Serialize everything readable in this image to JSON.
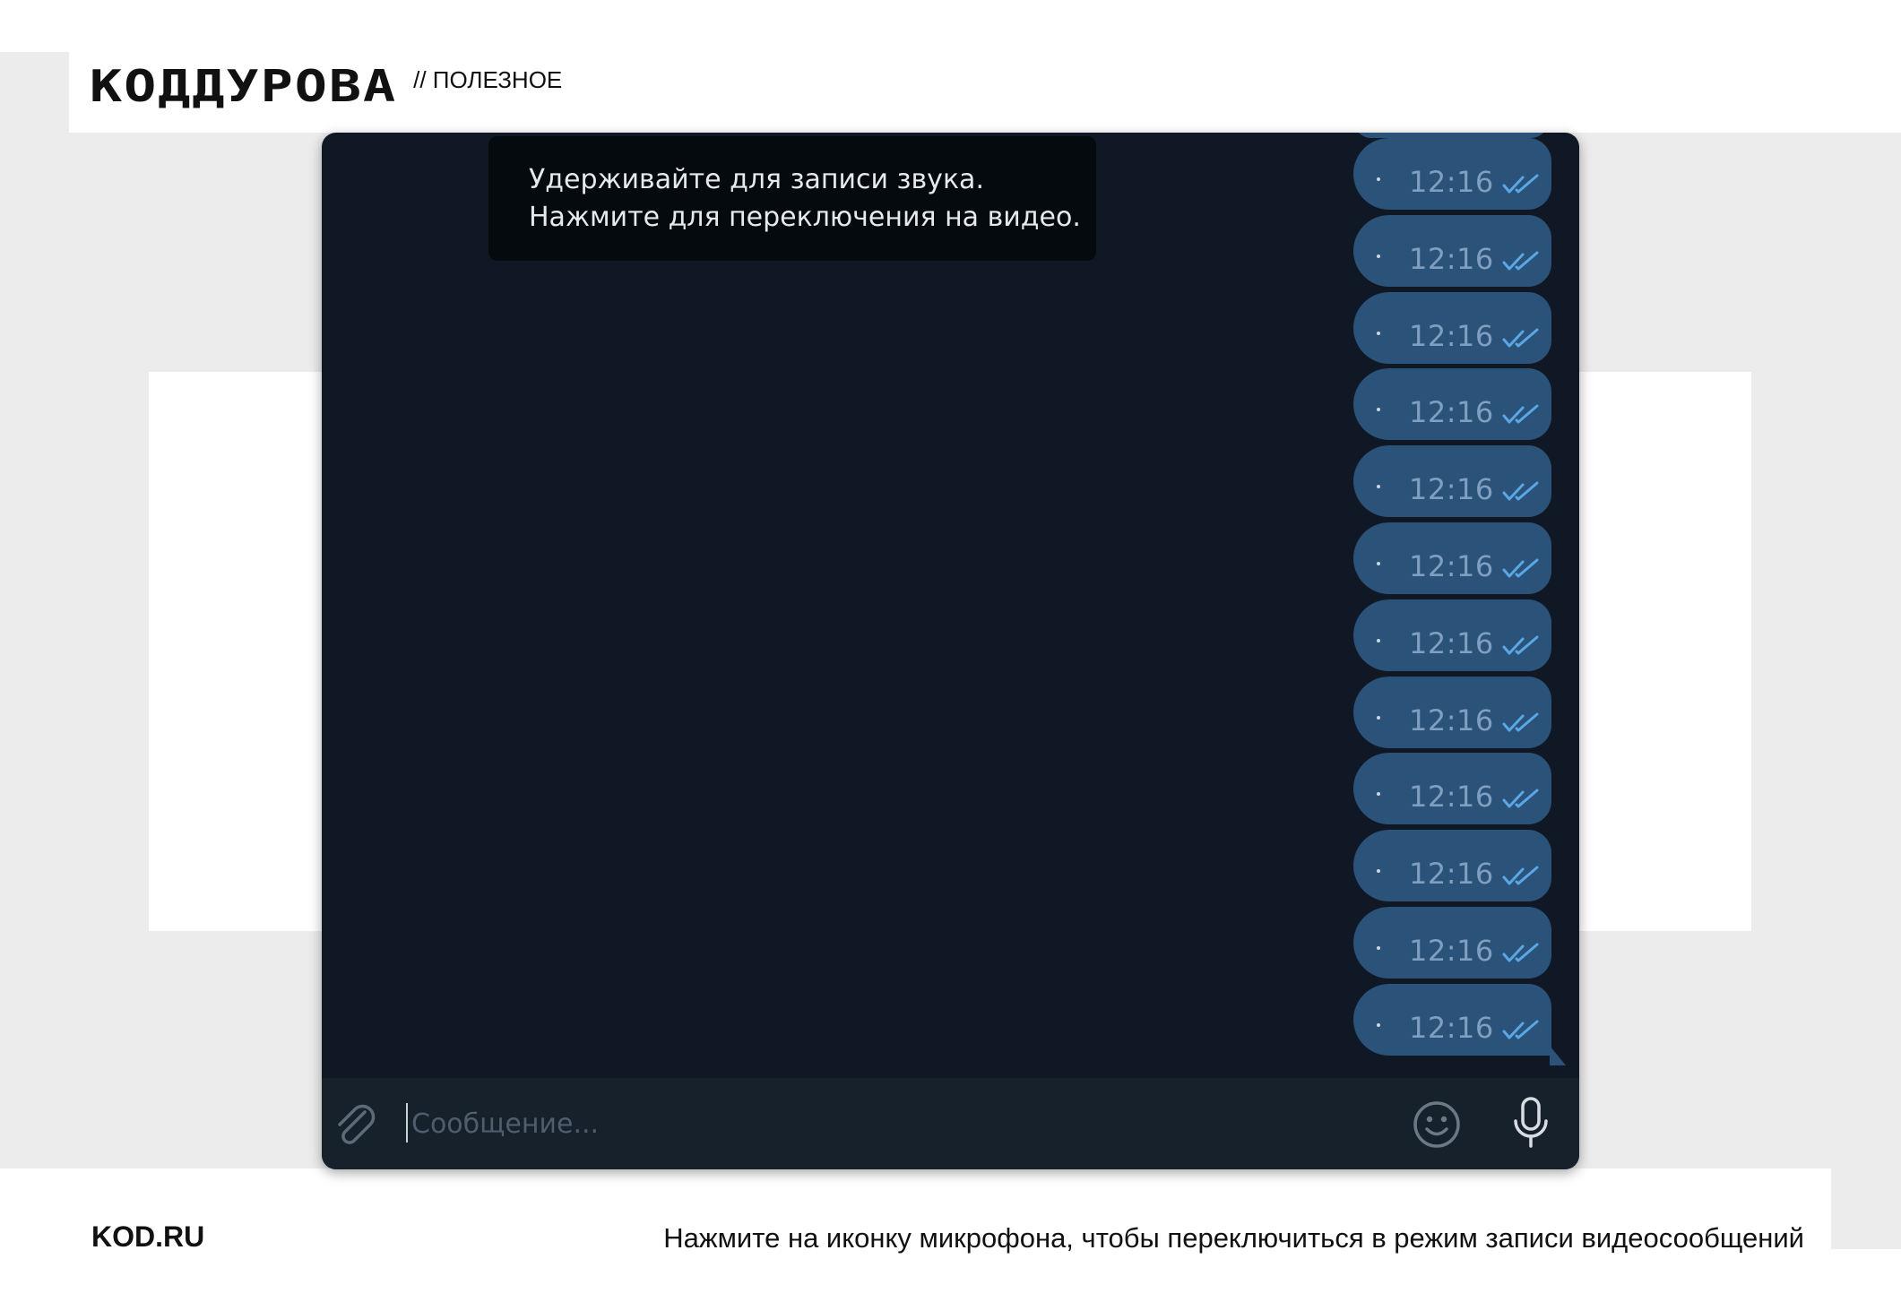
{
  "header": {
    "logo": "КОДДУРОВА",
    "section": "// ПОЛЕЗНОЕ"
  },
  "telegram": {
    "tooltip": {
      "line1": "Удерживайте для записи звука.",
      "line2": "Нажмите для переключения на видео."
    },
    "messages": [
      {
        "time": "12:16",
        "status": "double-check-icon"
      },
      {
        "time": "12:16",
        "status": "double-check-icon"
      },
      {
        "time": "12:16",
        "status": "double-check-icon"
      },
      {
        "time": "12:16",
        "status": "double-check-icon"
      },
      {
        "time": "12:16",
        "status": "double-check-icon"
      },
      {
        "time": "12:16",
        "status": "double-check-icon"
      },
      {
        "time": "12:16",
        "status": "double-check-icon"
      },
      {
        "time": "12:16",
        "status": "double-check-icon"
      },
      {
        "time": "12:16",
        "status": "double-check-icon"
      },
      {
        "time": "12:16",
        "status": "double-check-icon"
      },
      {
        "time": "12:16",
        "status": "double-check-icon"
      },
      {
        "time": "12:16",
        "status": "double-check-icon"
      }
    ],
    "input": {
      "value": "",
      "placeholder": "Сообщение..."
    },
    "icons": {
      "attach": "paperclip-icon",
      "emoji": "smile-icon",
      "mic": "microphone-icon"
    },
    "colors": {
      "chat_bg": "#101825",
      "bubble": "#2b5278",
      "time": "#7f9fc0",
      "ticks": "#5aa7e6",
      "input_bar": "#17212b"
    }
  },
  "footer": {
    "site": "KOD.RU",
    "caption": "Нажмите на иконку микрофона, чтобы переключиться в режим записи видеосообщений"
  }
}
